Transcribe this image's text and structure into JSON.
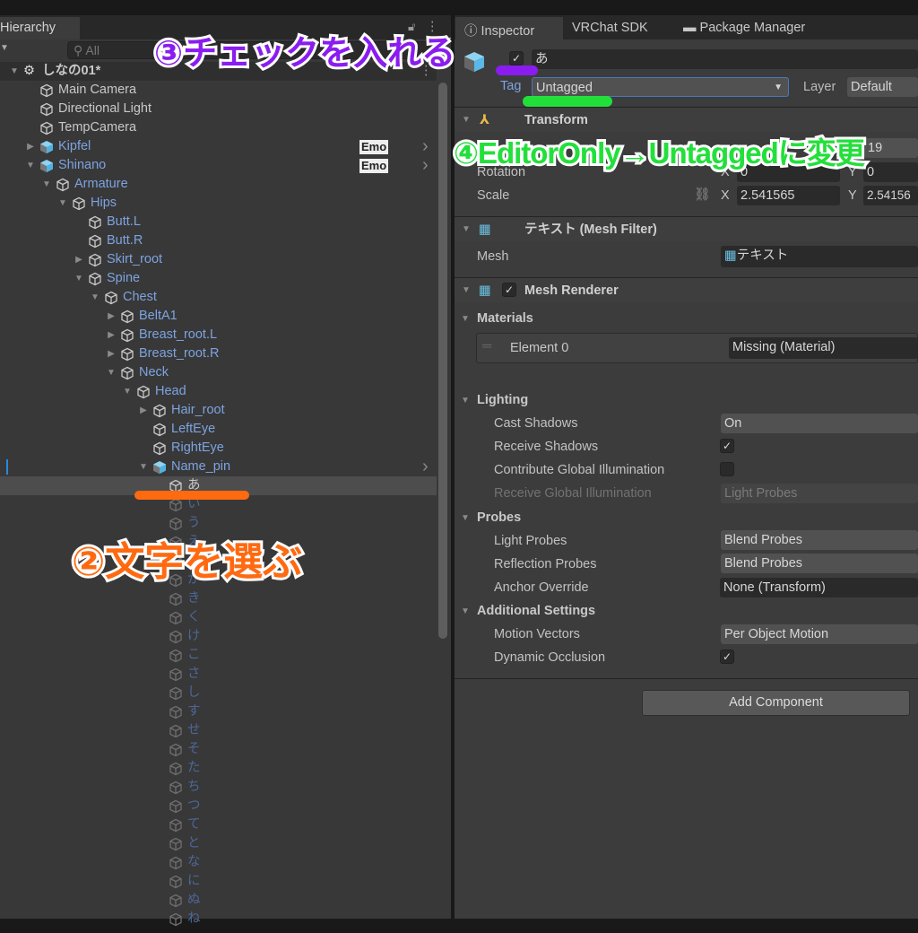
{
  "hierarchy": {
    "tab": "Hierarchy",
    "search_placeholder": "All",
    "rows": [
      {
        "label": "しなの01*",
        "depth": 0,
        "arrow": "down",
        "kind": "scene"
      },
      {
        "label": "Main Camera",
        "depth": 1
      },
      {
        "label": "Directional Light",
        "depth": 1
      },
      {
        "label": "TempCamera",
        "depth": 1
      },
      {
        "label": "Kipfel",
        "depth": 1,
        "arrow": "right",
        "prefab": true,
        "badge": "Emo",
        "chevron": true
      },
      {
        "label": "Shinano",
        "depth": 1,
        "arrow": "down",
        "prefab": true,
        "badge": "Emo",
        "chevron": true
      },
      {
        "label": "Armature",
        "depth": 2,
        "arrow": "down",
        "blue": true
      },
      {
        "label": "Hips",
        "depth": 3,
        "arrow": "down",
        "blue": true
      },
      {
        "label": "Butt.L",
        "depth": 4,
        "blue": true
      },
      {
        "label": "Butt.R",
        "depth": 4,
        "blue": true
      },
      {
        "label": "Skirt_root",
        "depth": 4,
        "arrow": "right",
        "blue": true
      },
      {
        "label": "Spine",
        "depth": 4,
        "arrow": "down",
        "blue": true
      },
      {
        "label": "Chest",
        "depth": 5,
        "arrow": "down",
        "blue": true
      },
      {
        "label": "BeltA1",
        "depth": 6,
        "arrow": "right",
        "blue": true
      },
      {
        "label": "Breast_root.L",
        "depth": 6,
        "arrow": "right",
        "blue": true
      },
      {
        "label": "Breast_root.R",
        "depth": 6,
        "arrow": "right",
        "blue": true
      },
      {
        "label": "Neck",
        "depth": 6,
        "arrow": "down",
        "blue": true
      },
      {
        "label": "Head",
        "depth": 7,
        "arrow": "down",
        "blue": true
      },
      {
        "label": "Hair_root",
        "depth": 8,
        "arrow": "right",
        "blue": true
      },
      {
        "label": "LeftEye",
        "depth": 8,
        "blue": true
      },
      {
        "label": "RightEye",
        "depth": 8,
        "blue": true
      },
      {
        "label": "Name_pin",
        "depth": 8,
        "arrow": "down",
        "prefab": true,
        "chevron": true,
        "mark": true
      },
      {
        "label": "あ",
        "depth": 9,
        "selected": true
      },
      {
        "label": "い",
        "depth": 9,
        "dim": true
      },
      {
        "label": "う",
        "depth": 9,
        "dim": true
      },
      {
        "label": "え",
        "depth": 9,
        "dim": true
      },
      {
        "label": "お",
        "depth": 9,
        "dim": true
      },
      {
        "label": "か",
        "depth": 9,
        "dim": true
      },
      {
        "label": "き",
        "depth": 9,
        "dim": true
      },
      {
        "label": "く",
        "depth": 9,
        "dim": true
      },
      {
        "label": "け",
        "depth": 9,
        "dim": true
      },
      {
        "label": "こ",
        "depth": 9,
        "dim": true
      },
      {
        "label": "さ",
        "depth": 9,
        "dim": true
      },
      {
        "label": "し",
        "depth": 9,
        "dim": true
      },
      {
        "label": "す",
        "depth": 9,
        "dim": true
      },
      {
        "label": "せ",
        "depth": 9,
        "dim": true
      },
      {
        "label": "そ",
        "depth": 9,
        "dim": true
      },
      {
        "label": "た",
        "depth": 9,
        "dim": true
      },
      {
        "label": "ち",
        "depth": 9,
        "dim": true
      },
      {
        "label": "つ",
        "depth": 9,
        "dim": true
      },
      {
        "label": "て",
        "depth": 9,
        "dim": true
      },
      {
        "label": "と",
        "depth": 9,
        "dim": true
      },
      {
        "label": "な",
        "depth": 9,
        "dim": true
      },
      {
        "label": "に",
        "depth": 9,
        "dim": true
      },
      {
        "label": "ぬ",
        "depth": 9,
        "dim": true
      },
      {
        "label": "ね",
        "depth": 9,
        "dim": true
      }
    ]
  },
  "inspector": {
    "tabs": [
      "Inspector",
      "VRChat SDK",
      "Package Manager"
    ],
    "object_name": "あ",
    "active": true,
    "tag_label": "Tag",
    "tag_value": "Untagged",
    "layer_label": "Layer",
    "layer_value": "Default",
    "transform": {
      "title": "Transform",
      "position_y": "19",
      "rotation_label": "Rotation",
      "rot_x_label": "X",
      "rot_x": "0",
      "rot_y_label": "Y",
      "rot_y": "0",
      "scale_label": "Scale",
      "scale_x_label": "X",
      "scale_x": "2.541565",
      "scale_y_label": "Y",
      "scale_y": "2.54156"
    },
    "mesh_filter": {
      "title": "テキスト (Mesh Filter)",
      "mesh_label": "Mesh",
      "mesh_value": "テキスト"
    },
    "mesh_renderer": {
      "title": "Mesh Renderer",
      "enabled": true,
      "materials_label": "Materials",
      "element_label": "Element 0",
      "element_value": "Missing (Material)",
      "lighting_label": "Lighting",
      "cast_shadows_label": "Cast Shadows",
      "cast_shadows": "On",
      "receive_shadows_label": "Receive Shadows",
      "receive_shadows": true,
      "contribute_gi_label": "Contribute Global Illumination",
      "contribute_gi": false,
      "receive_gi_label": "Receive Global Illumination",
      "receive_gi": "Light Probes",
      "probes_label": "Probes",
      "light_probes_label": "Light Probes",
      "light_probes": "Blend Probes",
      "reflection_probes_label": "Reflection Probes",
      "reflection_probes": "Blend Probes",
      "anchor_override_label": "Anchor Override",
      "anchor_override": "None (Transform)",
      "additional_label": "Additional Settings",
      "motion_vectors_label": "Motion Vectors",
      "motion_vectors": "Per Object Motion",
      "dynamic_occlusion_label": "Dynamic Occlusion",
      "dynamic_occlusion": true
    },
    "add_component": "Add Component"
  },
  "annotations": {
    "step3": "③チェックを入れる",
    "step4": "④EditorOnly→Untaggedに変更",
    "step2": "②文字を選ぶ",
    "colors": {
      "step3": "#8a1cf0",
      "step4": "#22e03a",
      "step2": "#ff6a10"
    }
  }
}
